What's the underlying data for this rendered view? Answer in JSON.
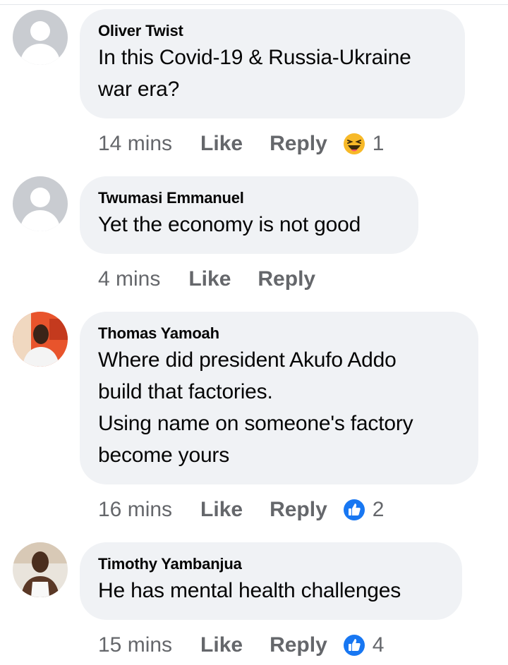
{
  "comments": [
    {
      "author": "Oliver Twist",
      "lines": [
        "In this Covid-19 & Russia-Ukraine",
        "war era?"
      ],
      "time": "14 mins",
      "like_label": "Like",
      "reply_label": "Reply",
      "reaction": {
        "icon": "haha-reaction-icon",
        "count": "1"
      },
      "avatar": "default-avatar"
    },
    {
      "author": "Twumasi Emmanuel",
      "lines": [
        "Yet the economy is not good"
      ],
      "time": "4 mins",
      "like_label": "Like",
      "reply_label": "Reply",
      "avatar": "default-avatar"
    },
    {
      "author": "Thomas Yamoah",
      "lines": [
        "Where did president Akufo Addo",
        "build that factories.",
        "Using name on someone's factory",
        "become yours"
      ],
      "time": "16 mins",
      "like_label": "Like",
      "reply_label": "Reply",
      "reaction": {
        "icon": "like-reaction-icon",
        "count": "2"
      },
      "avatar": "photo-avatar"
    },
    {
      "author": "Timothy Yambanjua",
      "lines": [
        "He has mental health challenges"
      ],
      "time": "15 mins",
      "like_label": "Like",
      "reply_label": "Reply",
      "reaction": {
        "icon": "like-reaction-icon",
        "count": "4"
      },
      "avatar": "photo-avatar"
    }
  ],
  "colors": {
    "bubble_bg": "#f0f2f5",
    "meta_text": "#65676b",
    "like_blue": "#1877f2",
    "haha_yellow": "#f7b928"
  }
}
